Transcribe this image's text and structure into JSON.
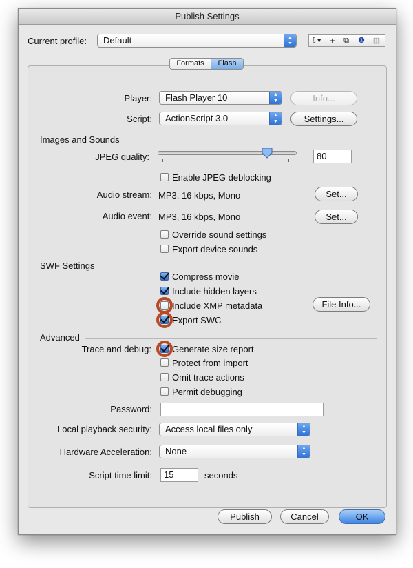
{
  "window": {
    "title": "Publish Settings"
  },
  "profile": {
    "label": "Current profile:",
    "value": "Default"
  },
  "tabs": [
    {
      "label": "Formats"
    },
    {
      "label": "Flash"
    }
  ],
  "player": {
    "label": "Player:",
    "value": "Flash Player 10",
    "info_label": "Info..."
  },
  "script": {
    "label": "Script:",
    "value": "ActionScript 3.0",
    "settings_label": "Settings..."
  },
  "images_sounds": {
    "title": "Images and Sounds",
    "jpeg_label": "JPEG quality:",
    "jpeg_value": "80",
    "jpeg_quality": 80,
    "deblocking_label": "Enable JPEG deblocking",
    "audio_stream_label": "Audio stream:",
    "audio_stream_value": "MP3, 16 kbps, Mono",
    "audio_event_label": "Audio event:",
    "audio_event_value": "MP3, 16 kbps, Mono",
    "set_label": "Set...",
    "override_label": "Override sound settings",
    "export_device_label": "Export device sounds"
  },
  "swf": {
    "title": "SWF Settings",
    "compress_label": "Compress movie",
    "hidden_layers_label": "Include hidden layers",
    "xmp_label": "Include XMP metadata",
    "swc_label": "Export SWC",
    "file_info_label": "File Info..."
  },
  "advanced": {
    "title": "Advanced",
    "trace_label": "Trace and debug:",
    "size_report_label": "Generate size report",
    "protect_label": "Protect from import",
    "omit_trace_label": "Omit trace actions",
    "permit_debug_label": "Permit debugging",
    "password_label": "Password:",
    "password_value": "",
    "local_security_label": "Local playback security:",
    "local_security_value": "Access local files only",
    "hw_accel_label": "Hardware Acceleration:",
    "hw_accel_value": "None",
    "time_limit_label": "Script time limit:",
    "time_limit_value": "15",
    "time_limit_unit": "seconds"
  },
  "footer": {
    "publish_label": "Publish",
    "cancel_label": "Cancel",
    "ok_label": "OK"
  },
  "colors": {
    "accent": "#3d86e6",
    "highlight_circle": "#b94a27"
  }
}
